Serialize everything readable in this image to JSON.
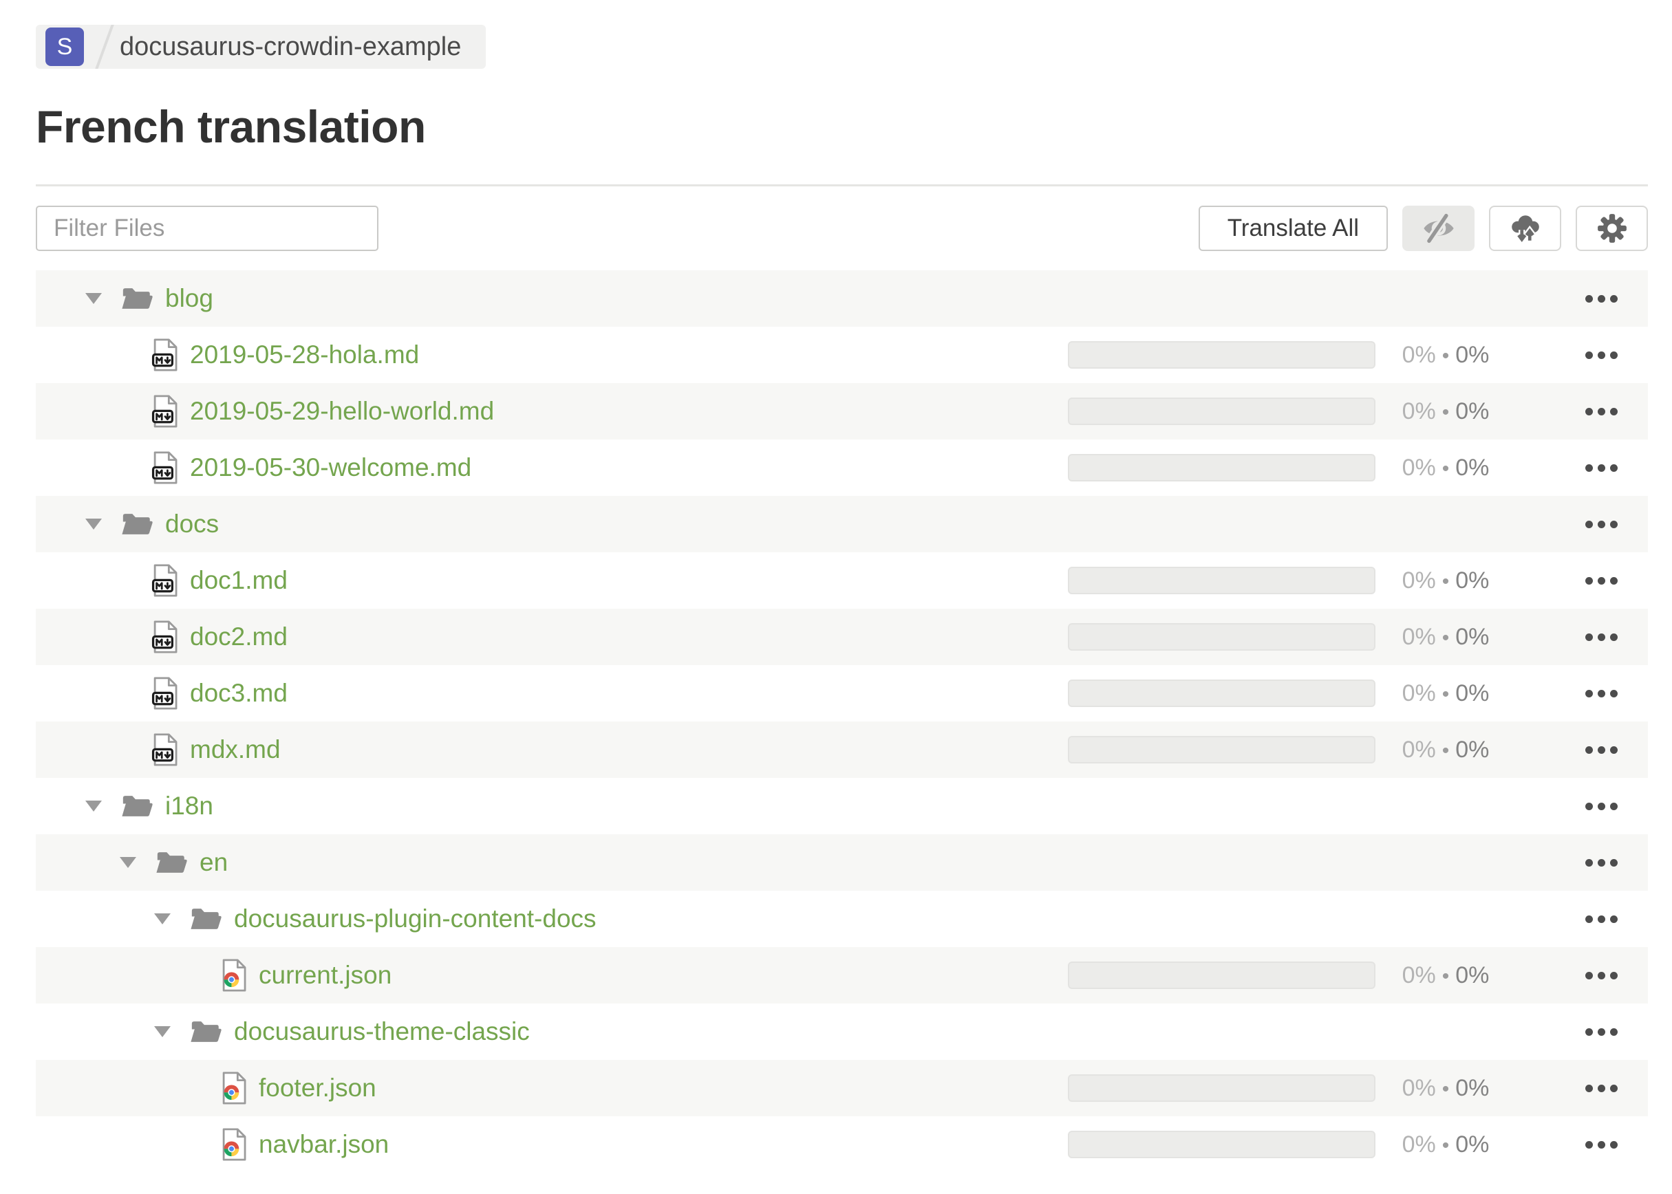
{
  "breadcrumb": {
    "project_initial": "S",
    "project_name": "docusaurus-crowdin-example"
  },
  "page": {
    "title": "French translation"
  },
  "toolbar": {
    "filter_placeholder": "Filter Files",
    "translate_all_label": "Translate All",
    "icon_buttons": [
      {
        "name": "hide-translated",
        "icon": "eye-off-icon",
        "active": true
      },
      {
        "name": "sync-files",
        "icon": "cloud-sync-icon",
        "active": false
      },
      {
        "name": "settings",
        "icon": "gear-icon",
        "active": false
      }
    ]
  },
  "colors": {
    "accent_green": "#74a54e",
    "badge_indigo": "#575fb7",
    "row_alt_bg": "#f7f7f5",
    "folder_gray": "#8c8c8c",
    "progress_track": "#ececea"
  },
  "tree": {
    "stats_separator": "•",
    "rows": [
      {
        "type": "folder",
        "level": 0,
        "icon": "folder-open-icon",
        "name": "blog"
      },
      {
        "type": "file",
        "level": 1,
        "icon": "markdown-file-icon",
        "name": "2019-05-28-hola.md",
        "translated": "0%",
        "approved": "0%"
      },
      {
        "type": "file",
        "level": 1,
        "icon": "markdown-file-icon",
        "name": "2019-05-29-hello-world.md",
        "translated": "0%",
        "approved": "0%"
      },
      {
        "type": "file",
        "level": 1,
        "icon": "markdown-file-icon",
        "name": "2019-05-30-welcome.md",
        "translated": "0%",
        "approved": "0%"
      },
      {
        "type": "folder",
        "level": 0,
        "icon": "folder-open-icon",
        "name": "docs"
      },
      {
        "type": "file",
        "level": 1,
        "icon": "markdown-file-icon",
        "name": "doc1.md",
        "translated": "0%",
        "approved": "0%"
      },
      {
        "type": "file",
        "level": 1,
        "icon": "markdown-file-icon",
        "name": "doc2.md",
        "translated": "0%",
        "approved": "0%"
      },
      {
        "type": "file",
        "level": 1,
        "icon": "markdown-file-icon",
        "name": "doc3.md",
        "translated": "0%",
        "approved": "0%"
      },
      {
        "type": "file",
        "level": 1,
        "icon": "markdown-file-icon",
        "name": "mdx.md",
        "translated": "0%",
        "approved": "0%"
      },
      {
        "type": "folder",
        "level": 0,
        "icon": "folder-open-icon",
        "name": "i18n"
      },
      {
        "type": "folder",
        "level": 1,
        "icon": "folder-open-icon",
        "name": "en"
      },
      {
        "type": "folder",
        "level": 2,
        "icon": "folder-open-icon",
        "name": "docusaurus-plugin-content-docs"
      },
      {
        "type": "file",
        "level": 3,
        "icon": "json-file-icon",
        "name": "current.json",
        "translated": "0%",
        "approved": "0%"
      },
      {
        "type": "folder",
        "level": 2,
        "icon": "folder-open-icon",
        "name": "docusaurus-theme-classic"
      },
      {
        "type": "file",
        "level": 3,
        "icon": "json-file-icon",
        "name": "footer.json",
        "translated": "0%",
        "approved": "0%"
      },
      {
        "type": "file",
        "level": 3,
        "icon": "json-file-icon",
        "name": "navbar.json",
        "translated": "0%",
        "approved": "0%"
      }
    ]
  }
}
